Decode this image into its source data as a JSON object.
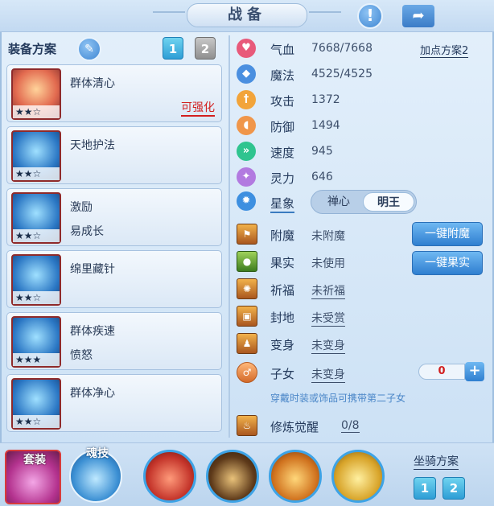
{
  "title": "战备",
  "icons": {
    "help": "help-icon",
    "share": "share-icon",
    "edit": "pencil-icon"
  },
  "left": {
    "plan_label": "装备方案",
    "plan_tabs": [
      "1",
      "2"
    ],
    "skills": [
      {
        "name": "群体清心",
        "sub": "",
        "enhance": "可强化",
        "stars": "★★☆"
      },
      {
        "name": "天地护法",
        "sub": "",
        "enhance": "",
        "stars": "★★☆"
      },
      {
        "name": "激励",
        "sub": "易成长",
        "enhance": "",
        "stars": "★★☆"
      },
      {
        "name": "绵里藏针",
        "sub": "",
        "enhance": "",
        "stars": "★★☆"
      },
      {
        "name": "群体疾速",
        "sub": "愤怒",
        "enhance": "",
        "stars": "★★★"
      },
      {
        "name": "群体净心",
        "sub": "",
        "enhance": "",
        "stars": "★★☆"
      }
    ]
  },
  "stats": {
    "add_plan": "加点方案2",
    "rows": [
      {
        "label": "气血",
        "value": "7668/7668",
        "icon": "heart-icon",
        "color": "#e8597a"
      },
      {
        "label": "魔法",
        "value": "4525/4525",
        "icon": "mana-icon",
        "color": "#4a8fe0"
      },
      {
        "label": "攻击",
        "value": "1372",
        "icon": "sword-icon",
        "color": "#f2a43a"
      },
      {
        "label": "防御",
        "value": "1494",
        "icon": "shield-icon",
        "color": "#f0964a"
      },
      {
        "label": "速度",
        "value": "945",
        "icon": "speed-icon",
        "color": "#2fc48f"
      },
      {
        "label": "灵力",
        "value": "646",
        "icon": "spirit-icon",
        "color": "#b27ae0"
      }
    ],
    "star_sign": {
      "label": "星象",
      "options": [
        "禅心",
        "明王"
      ],
      "selected": "明王"
    }
  },
  "features": [
    {
      "label": "附魔",
      "value": "未附魔",
      "icon": "enchant-icon"
    },
    {
      "label": "果实",
      "value": "未使用",
      "icon": "fruit-icon"
    },
    {
      "label": "祈福",
      "value": "未祈福",
      "icon": "blessing-icon"
    },
    {
      "label": "封地",
      "value": "未受赏",
      "icon": "fief-icon"
    },
    {
      "label": "变身",
      "value": "未变身",
      "icon": "transform-icon"
    },
    {
      "label": "子女",
      "value": "未变身",
      "icon": "child-icon"
    }
  ],
  "buttons": {
    "enchant_all": "一键附魔",
    "fruit_all": "一键果实"
  },
  "child_counter": "0",
  "hint": "穿戴时装或饰品可携带第二子女",
  "cultivation": {
    "label": "修炼觉醒",
    "value": "0/8"
  },
  "bottom": {
    "suit": "套装",
    "soul": "魂技",
    "mounts": [
      "mount-1",
      "mount-2",
      "mount-3",
      "mount-4"
    ],
    "mount_plan_label": "坐骑方案",
    "mount_tabs": [
      "1",
      "2"
    ]
  }
}
